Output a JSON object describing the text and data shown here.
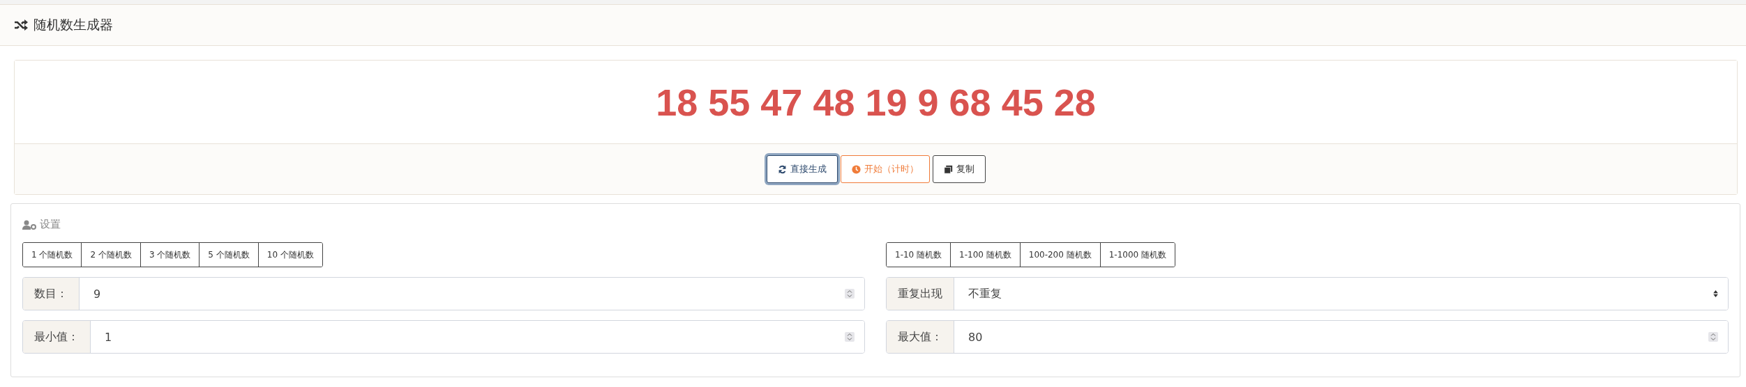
{
  "header": {
    "title": "随机数生成器"
  },
  "result": {
    "numbers": "18 55 47 48 19 9 68 45 28"
  },
  "actions": [
    {
      "kind": "generate",
      "label": "直接生成",
      "focused": true
    },
    {
      "kind": "timer",
      "label": "开始（计时）",
      "focused": false
    },
    {
      "kind": "copy",
      "label": "复制",
      "focused": false
    }
  ],
  "settings": {
    "title": "设置",
    "count_presets": [
      "1 个随机数",
      "2 个随机数",
      "3 个随机数",
      "5 个随机数",
      "10 个随机数"
    ],
    "range_presets": [
      "1-10 随机数",
      "1-100 随机数",
      "100-200 随机数",
      "1-1000 随机数"
    ],
    "fields": [
      {
        "kind": "number",
        "label": "数目：",
        "value": "9"
      },
      {
        "kind": "select",
        "label": "重复出现",
        "value": "不重复"
      },
      {
        "kind": "number",
        "label": "最小值：",
        "value": "1"
      },
      {
        "kind": "number",
        "label": "最大值：",
        "value": "80"
      }
    ]
  }
}
